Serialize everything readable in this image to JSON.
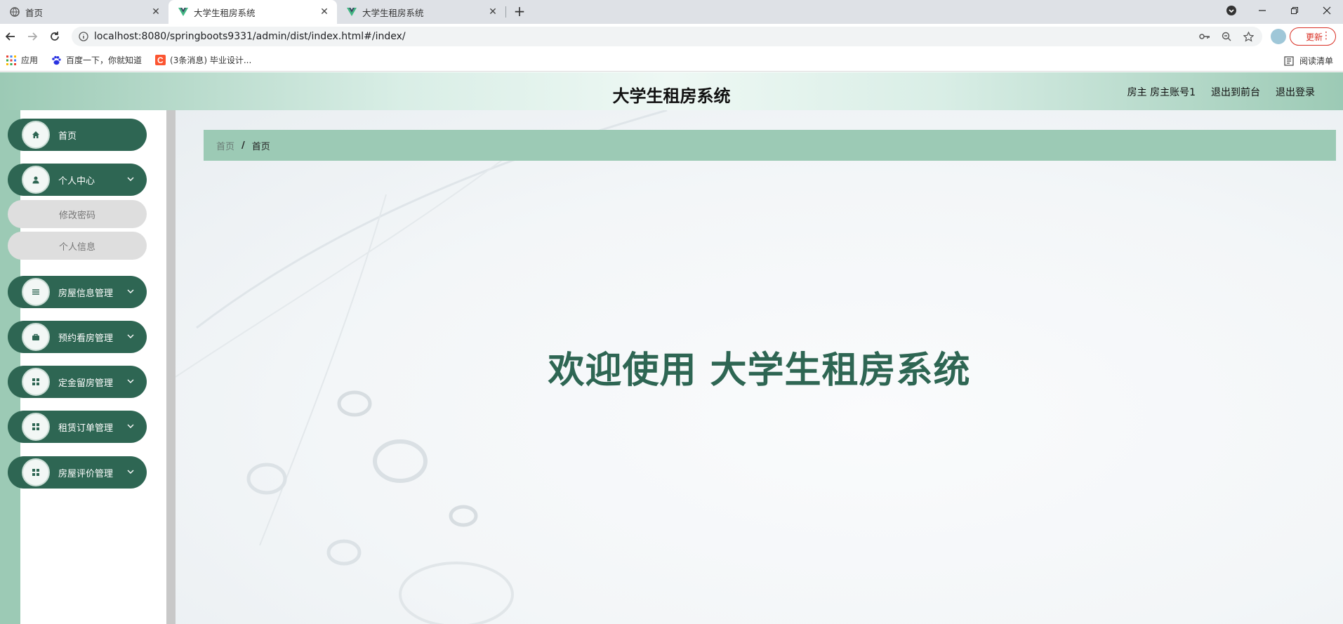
{
  "browser": {
    "tabs": [
      {
        "title": "首页",
        "icon": "globe-icon",
        "active": false
      },
      {
        "title": "大学生租房系统",
        "icon": "vue-logo-icon",
        "active": true
      },
      {
        "title": "大学生租房系统",
        "icon": "vue-logo-icon",
        "active": false
      }
    ],
    "url": "localhost:8080/springboots9331/admin/dist/index.html#/index/",
    "update_label": "更新",
    "bookmarks": [
      {
        "label": "应用",
        "icon": "apps-grid-icon"
      },
      {
        "label": "百度一下，你就知道",
        "icon": "baidu-paw-icon"
      },
      {
        "label": "(3条消息) 毕业设计...",
        "icon": "csdn-c-icon"
      }
    ],
    "reading_list": "阅读清单"
  },
  "app": {
    "title": "大学生租房系统",
    "header_links": [
      "房主 房主账号1",
      "退出到前台",
      "退出登录"
    ]
  },
  "sidebar": {
    "menu": [
      {
        "label": "首页",
        "icon": "home-icon",
        "has_children": false
      },
      {
        "label": "个人中心",
        "icon": "user-icon",
        "has_children": true,
        "expanded": true,
        "children": [
          "修改密码",
          "个人信息"
        ]
      },
      {
        "label": "房屋信息管理",
        "icon": "list-icon",
        "has_children": true
      },
      {
        "label": "预约看房管理",
        "icon": "briefcase-icon",
        "has_children": true
      },
      {
        "label": "定金留房管理",
        "icon": "grid-icon",
        "has_children": true
      },
      {
        "label": "租赁订单管理",
        "icon": "grid-icon",
        "has_children": true
      },
      {
        "label": "房屋评价管理",
        "icon": "grid-icon",
        "has_children": true
      }
    ]
  },
  "breadcrumb": {
    "home": "首页",
    "separator": "/",
    "current": "首页"
  },
  "main": {
    "welcome": "欢迎使用 大学生租房系统"
  },
  "colors": {
    "primary": "#2e6653",
    "accent": "#9ccab5",
    "submenu": "#dedede"
  }
}
